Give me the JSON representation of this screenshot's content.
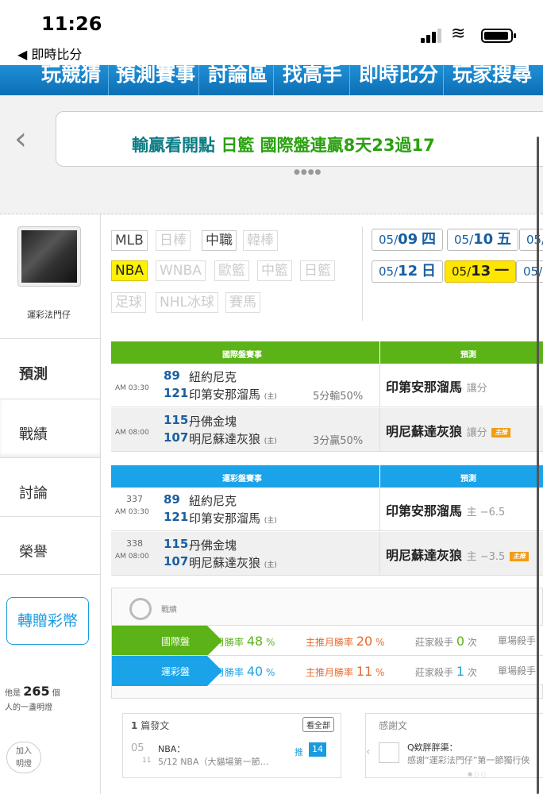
{
  "status": {
    "time": "11:26",
    "back": "◀ 即時比分"
  },
  "topnav": [
    "玩競猜",
    "預測賽事",
    "討論區",
    "找高手",
    "即時比分",
    "玩家搜尋"
  ],
  "banner": {
    "part1": "輸贏看開點",
    "part2": "日籃 國際盤連贏8天23過17"
  },
  "user": {
    "name": "運彩法門仔"
  },
  "sidebar": {
    "items": [
      "預測",
      "戰績",
      "討論",
      "榮譽"
    ],
    "gift": "轉贈彩幣",
    "light_prefix": "他是",
    "light_count": "265",
    "light_unit": "個",
    "light_suffix": "人的一盞明燈",
    "add": "加入",
    "add2": "明燈"
  },
  "leagues": [
    {
      "label": "MLB",
      "state": "normal"
    },
    {
      "label": "日棒",
      "state": "dim"
    },
    {
      "label": "中職",
      "state": "normal"
    },
    {
      "label": "韓棒",
      "state": "dim"
    },
    {
      "label": "NBA",
      "state": "sel"
    },
    {
      "label": "WNBA",
      "state": "dim"
    },
    {
      "label": "歐籃",
      "state": "dim"
    },
    {
      "label": "中籃",
      "state": "dim"
    },
    {
      "label": "日籃",
      "state": "dim"
    },
    {
      "label": "足球",
      "state": "dim"
    },
    {
      "label": "NHL冰球",
      "state": "dim"
    },
    {
      "label": "賽馬",
      "state": "dim"
    }
  ],
  "dates": [
    {
      "md": "05/",
      "d": "09",
      "w": "四"
    },
    {
      "md": "05/",
      "d": "10",
      "w": "五"
    },
    {
      "md": "05/",
      "d": "",
      "w": ""
    },
    {
      "md": "05/",
      "d": "12",
      "w": "日"
    },
    {
      "md": "05/",
      "d": "13",
      "w": "一"
    },
    {
      "md": "05/",
      "d": "",
      "w": ""
    }
  ],
  "intl": {
    "title": "國際盤賽事",
    "pred_title": "預測",
    "color": "#5bb317",
    "rows": [
      {
        "time": "AM 03:30",
        "n1": "89",
        "t1": "紐約尼克",
        "n2": "121",
        "t2": "印第安那溜馬",
        "home": "(主)",
        "result": "5分輸50%",
        "pick": "印第安那溜馬",
        "pick_note": "讓分",
        "badge": ""
      },
      {
        "time": "AM 08:00",
        "n1": "115",
        "t1": "丹佛金塊",
        "n2": "107",
        "t2": "明尼蘇達灰狼",
        "home": "(主)",
        "result": "3分贏50%",
        "pick": "明尼蘇達灰狼",
        "pick_note": "讓分",
        "badge": "主推"
      }
    ]
  },
  "sports": {
    "title": "運彩盤賽事",
    "pred_title": "預測",
    "color": "#1aa3e8",
    "rows": [
      {
        "no": "337",
        "time": "AM 03:30",
        "n1": "89",
        "t1": "紐約尼克",
        "n2": "121",
        "t2": "印第安那溜馬",
        "home": "(主)",
        "pick": "印第安那溜馬",
        "pick_note": "主 −6.5",
        "badge": ""
      },
      {
        "no": "338",
        "time": "AM 08:00",
        "n1": "115",
        "t1": "丹佛金塊",
        "n2": "107",
        "t2": "明尼蘇達灰狼",
        "home": "(主)",
        "pick": "明尼蘇達灰狼",
        "pick_note": "主 −3.5",
        "badge": "主推"
      }
    ]
  },
  "stats": {
    "title": "戰績",
    "rows": [
      {
        "tag": "國際盤",
        "color": "#5bb317",
        "month_label": "月勝率",
        "month": "48",
        "main_label": "主推月勝率",
        "main": "20",
        "killer_label": "莊家殺手",
        "killer": "0",
        "killer_unit": "次",
        "single": "單場殺手"
      },
      {
        "tag": "運彩盤",
        "color": "#1aa3e8",
        "month_label": "月勝率",
        "month": "40",
        "main_label": "主推月勝率",
        "main": "11",
        "killer_label": "莊家殺手",
        "killer": "1",
        "killer_unit": "次",
        "single": "單場殺手"
      }
    ]
  },
  "posts": {
    "count": "1",
    "label": "篇發文",
    "viewall": "看全部",
    "date_m": "05",
    "date_d": "11",
    "title": "NBA：",
    "snippet": "5/12 NBA（大貓場第一節…",
    "push": "推",
    "push_n": "14"
  },
  "thanks": {
    "label": "感謝文",
    "who": "Q欸胖胖渠：",
    "text": "感謝“運彩法門仔”第一節獨行俠"
  }
}
